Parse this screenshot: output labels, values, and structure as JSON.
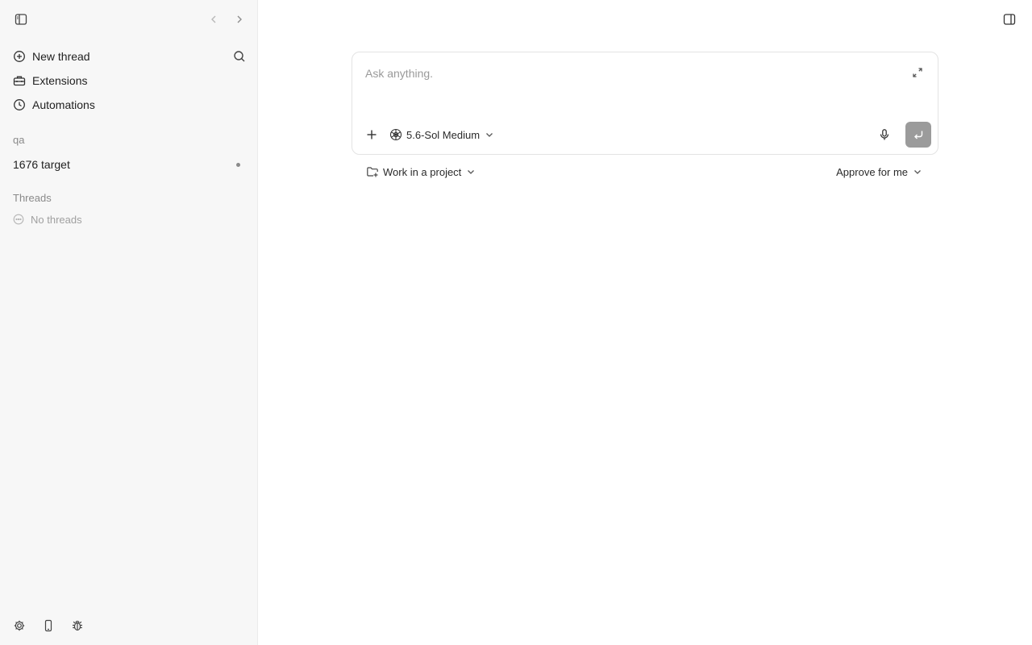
{
  "sidebar": {
    "icons": {
      "toggle": "sidebar-toggle-icon",
      "back": "chevron-left-icon",
      "forward": "chevron-right-icon",
      "search": "search-icon"
    },
    "nav": [
      {
        "label": "New thread",
        "icon": "plus-circle-icon"
      },
      {
        "label": "Extensions",
        "icon": "toolbox-icon"
      },
      {
        "label": "Automations",
        "icon": "clock-icon"
      }
    ],
    "project_section_label": "qa",
    "project": {
      "label": "1676 target"
    },
    "threads_label": "Threads",
    "no_threads_label": "No threads",
    "footer_icons": [
      "gear-icon",
      "mobile-icon",
      "bug-icon"
    ]
  },
  "composer": {
    "placeholder": "Ask anything.",
    "model_label": "5.6-Sol Medium",
    "send_color": "#9b9b9b"
  },
  "options": {
    "project_label": "Work in a project",
    "approval_label": "Approve for me"
  }
}
